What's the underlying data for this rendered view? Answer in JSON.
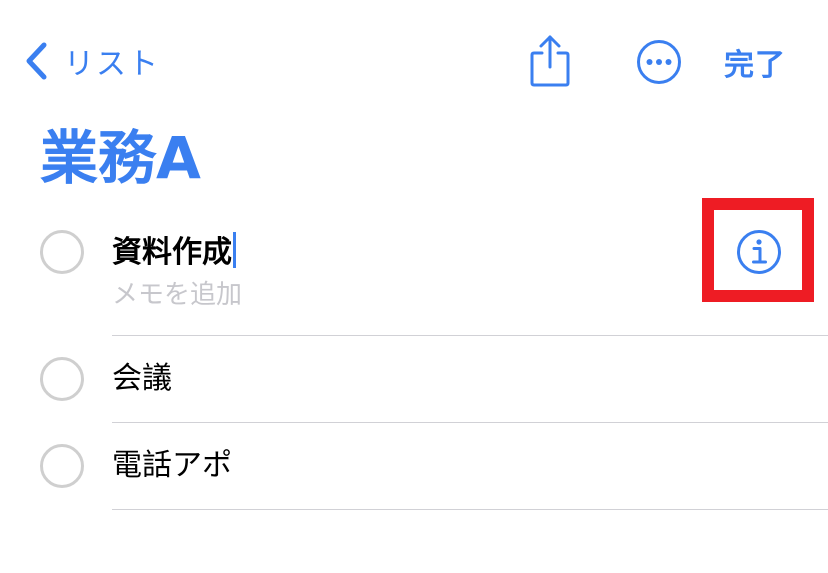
{
  "nav": {
    "back_label": "リスト",
    "done_label": "完了"
  },
  "list": {
    "title": "業務A",
    "items": [
      {
        "title": "資料作成",
        "note_placeholder": "メモを追加",
        "editing": true
      },
      {
        "title": "会議"
      },
      {
        "title": "電話アポ"
      }
    ]
  },
  "icons": {
    "back": "chevron-left-icon",
    "share": "share-icon",
    "more": "ellipsis-circle-icon",
    "info": "info-circle-icon"
  },
  "colors": {
    "accent": "#3a7ff0",
    "highlight": "#ee1c24",
    "placeholder": "#c7c7cc",
    "checkbox_border": "#cfcfcf"
  }
}
